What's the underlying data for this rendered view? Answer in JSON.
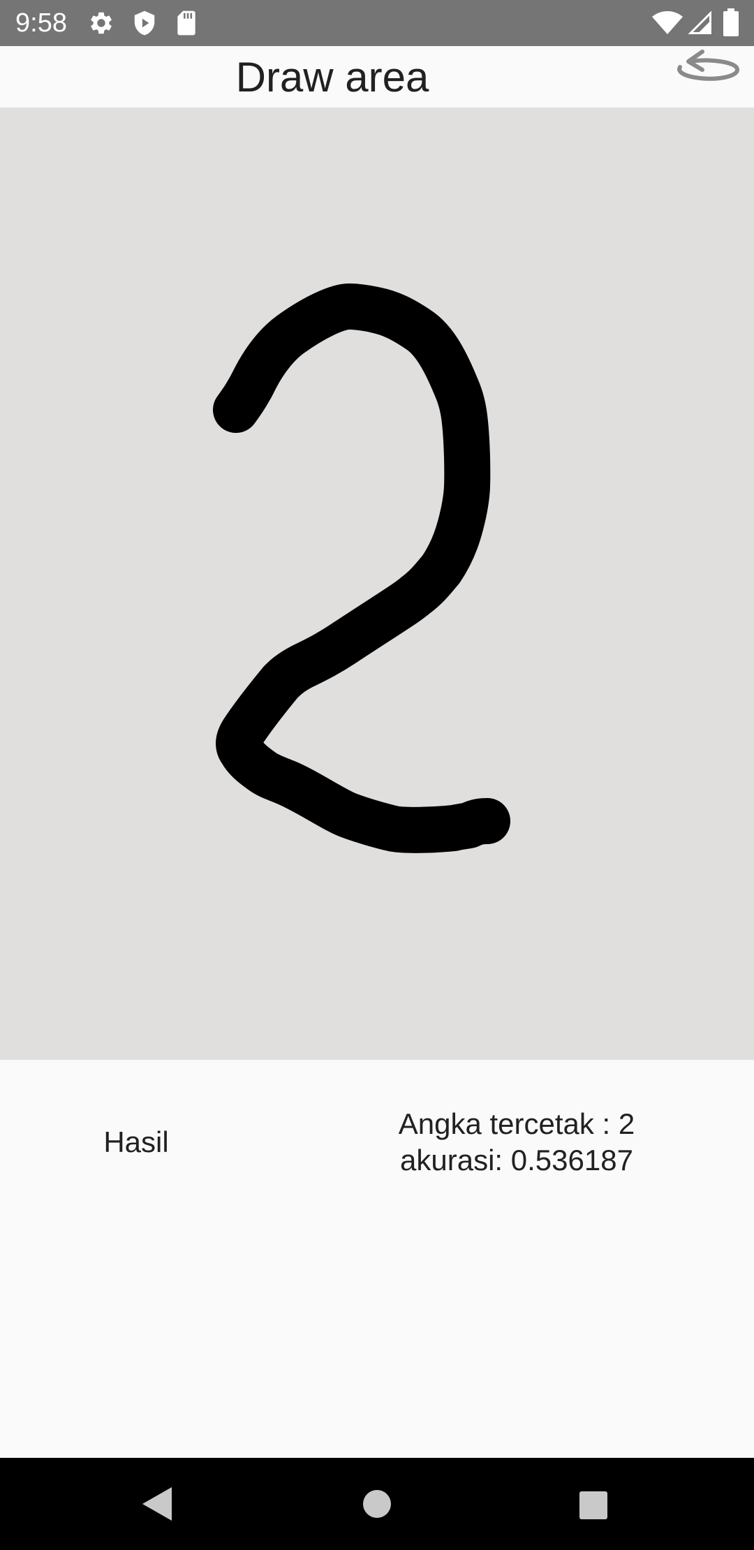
{
  "status_bar": {
    "time": "9:58",
    "left_icons": [
      "gear-icon",
      "shield-play-icon",
      "sd-card-icon"
    ],
    "right_icons": [
      "wifi-icon",
      "cell-signal-icon",
      "battery-icon"
    ]
  },
  "app_bar": {
    "title": "Draw area",
    "undo_icon": "undo-icon"
  },
  "canvas": {
    "background_color": "#e0dfde",
    "stroke_color": "#000000"
  },
  "result": {
    "label": "Hasil",
    "predicted_line": "Angka tercetak : 2",
    "accuracy_line": "akurasi: 0.536187"
  },
  "nav_bar": {
    "back_icon": "back-triangle-icon",
    "home_icon": "home-circle-icon",
    "recents_icon": "recents-square-icon"
  }
}
